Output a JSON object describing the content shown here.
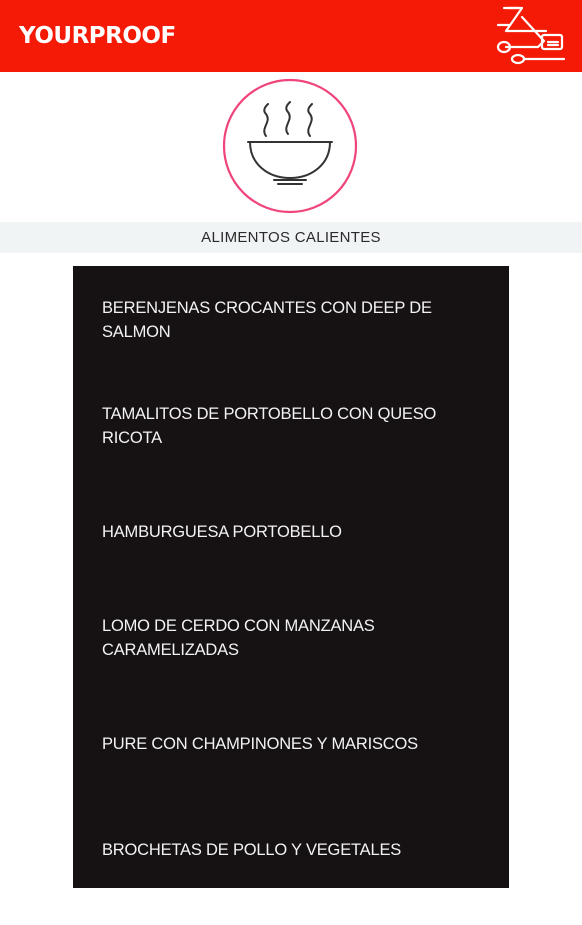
{
  "app": {
    "title": "YOURPROOF"
  },
  "header": {
    "menu_icon": "utensils-menu-icon"
  },
  "hero": {
    "icon": "hot-bowl-icon"
  },
  "category": {
    "label": "ALIMENTOS CALIENTES"
  },
  "dishes": [
    {
      "name": "BERENJENAS CROCANTES CON DEEP DE SALMON"
    },
    {
      "name": "TAMALITOS DE PORTOBELLO CON QUESO RICOTA"
    },
    {
      "name": "HAMBURGUESA PORTOBELLO"
    },
    {
      "name": "LOMO DE CERDO CON MANZANAS CARAMELIZADAS"
    },
    {
      "name": "PURE CON CHAMPINONES Y MARISCOS"
    },
    {
      "name": "BROCHETAS DE POLLO Y VEGETALES"
    }
  ],
  "colors": {
    "appbar": "#f51a06",
    "accent_ring": "#f0457a",
    "panel": "#161112",
    "category_bar": "#f1f4f5"
  }
}
